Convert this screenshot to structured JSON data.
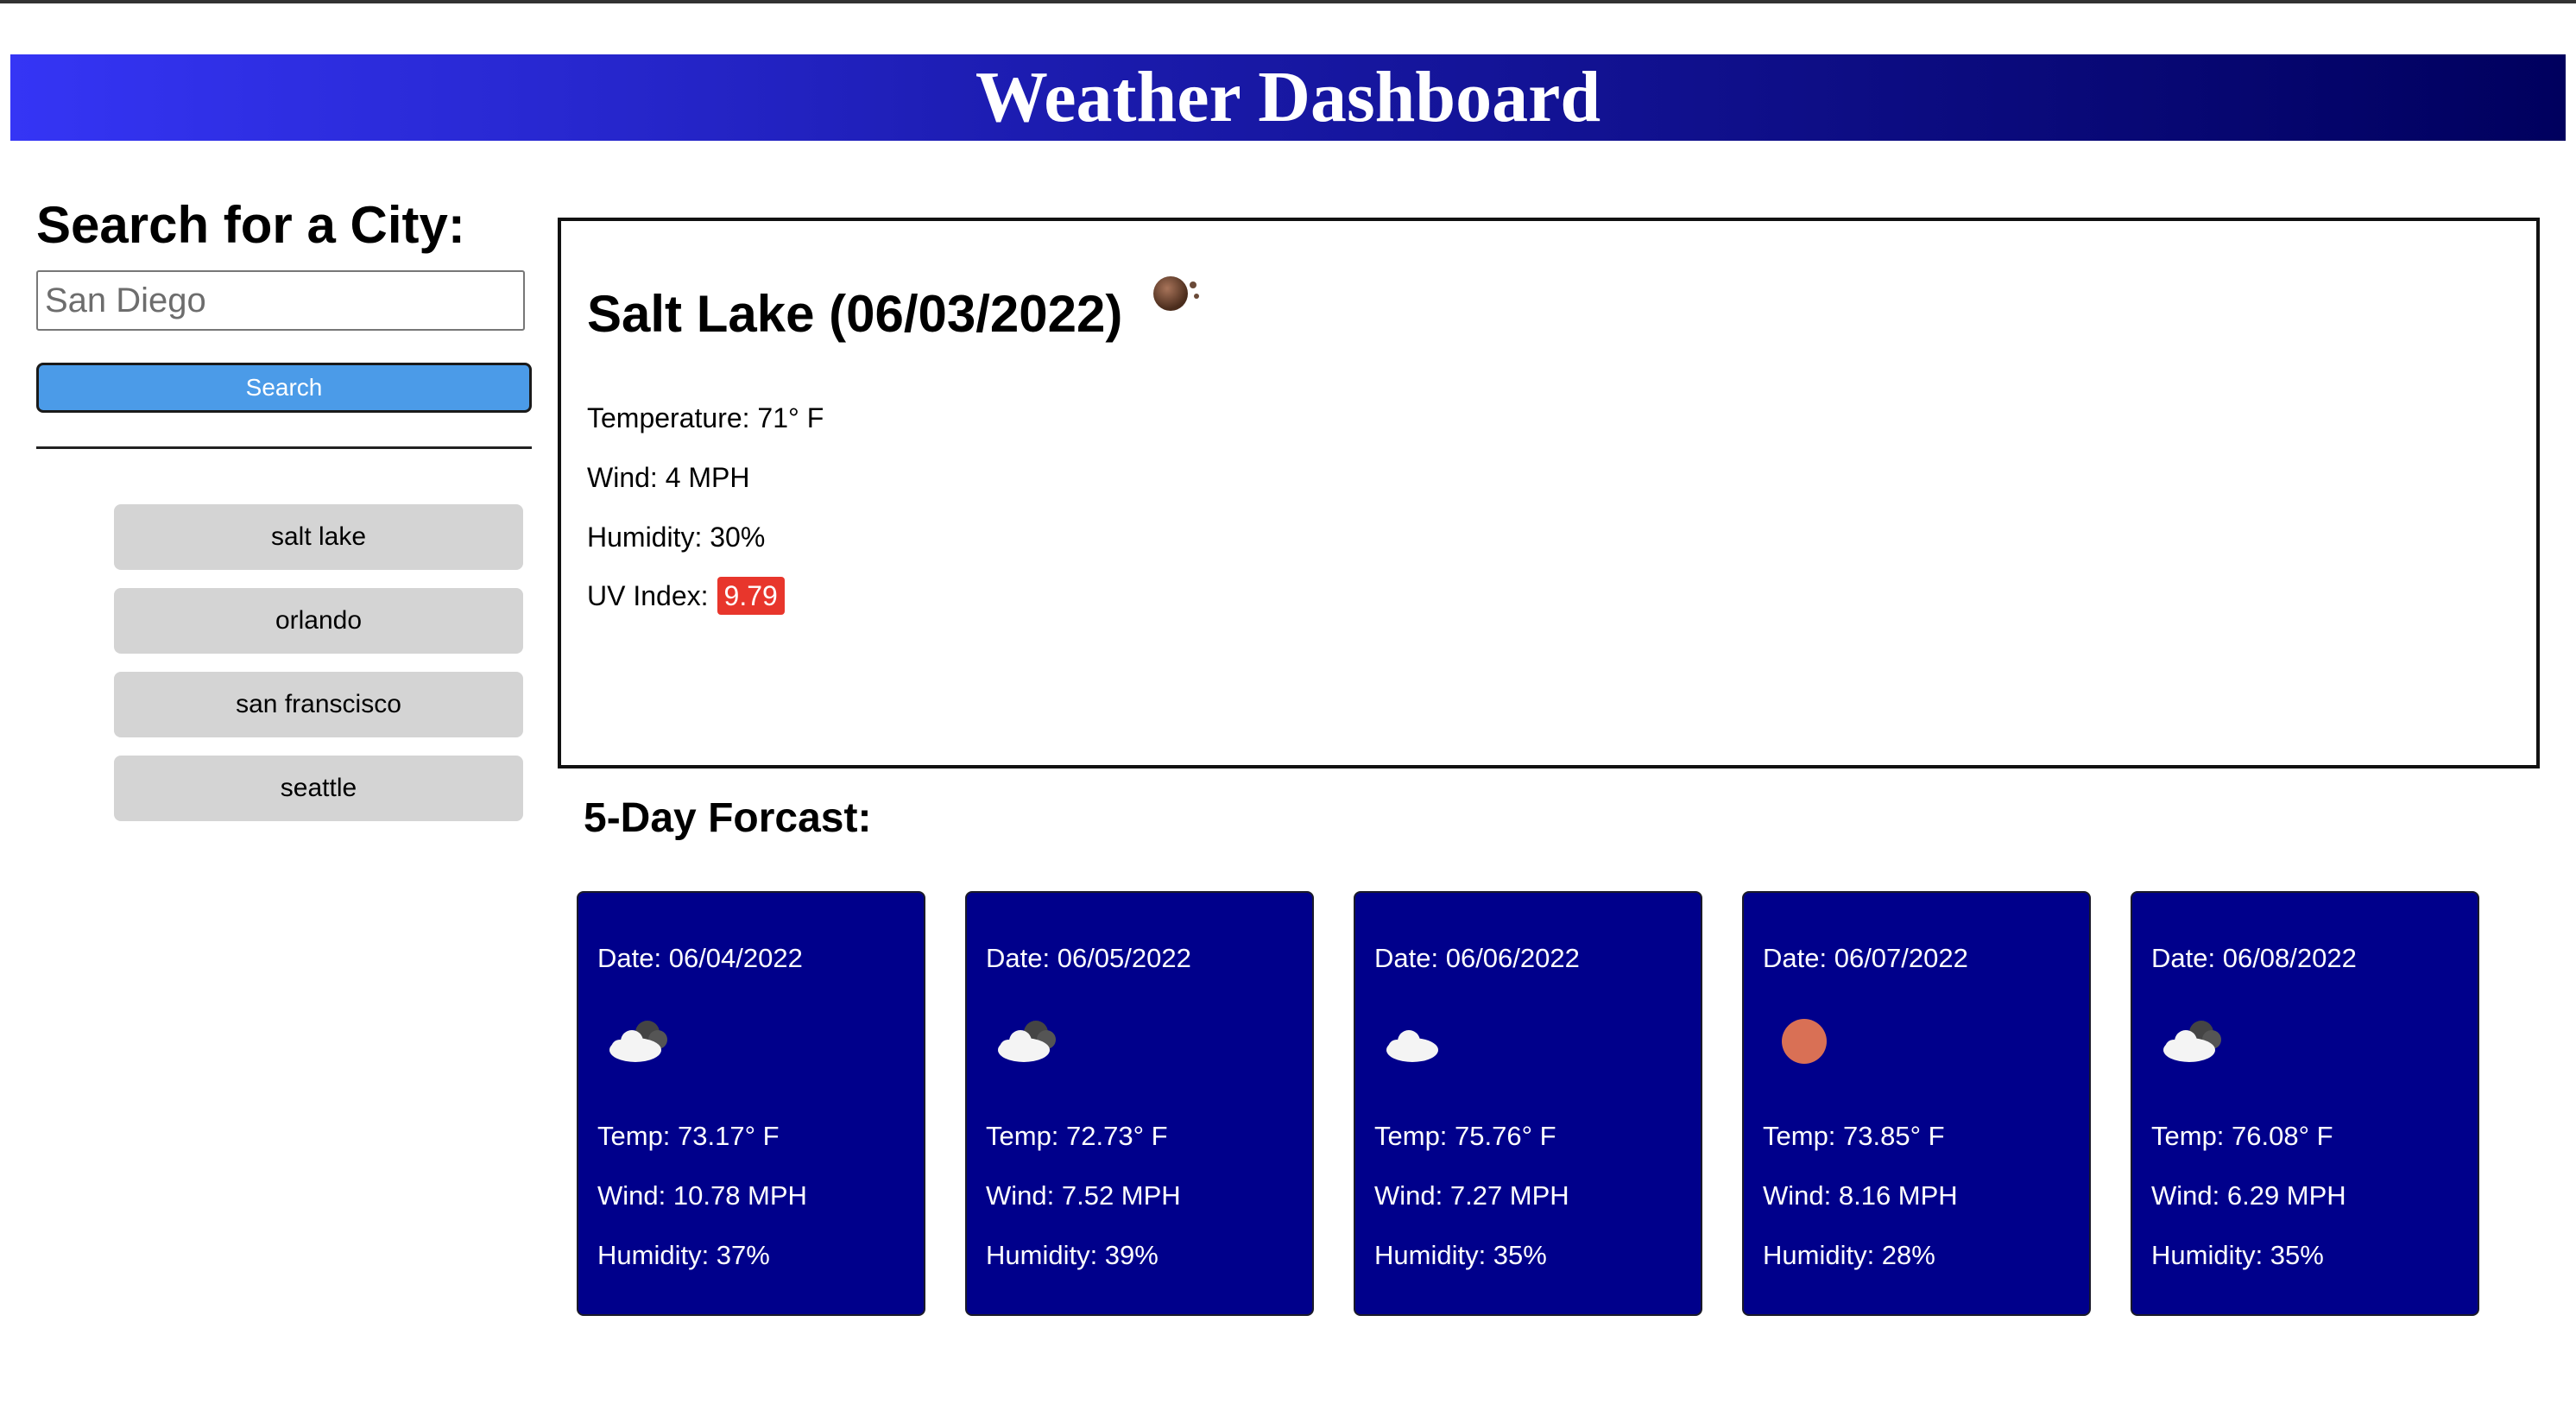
{
  "header": {
    "title": "Weather Dashboard"
  },
  "sidebar": {
    "title": "Search for a City:",
    "search_placeholder": "San Diego",
    "search_button_label": "Search",
    "history": [
      "salt lake",
      "orlando",
      "san franscisco",
      "seattle"
    ]
  },
  "current": {
    "title": "Salt Lake (06/03/2022)",
    "icon": "moon-icon",
    "temperature": "Temperature: 71° F",
    "wind": "Wind: 4 MPH",
    "humidity": "Humidity: 30%",
    "uv_label": "UV Index:",
    "uv_value": "9.79",
    "uv_color": "#e8362c"
  },
  "forecast": {
    "title": "5-Day Forcast:",
    "days": [
      {
        "date": "Date: 06/04/2022",
        "icon": "cloud-night-icon",
        "temp": "Temp: 73.17° F",
        "wind": "Wind: 10.78 MPH",
        "humidity": "Humidity: 37%"
      },
      {
        "date": "Date: 06/05/2022",
        "icon": "cloud-night-icon",
        "temp": "Temp: 72.73° F",
        "wind": "Wind: 7.52 MPH",
        "humidity": "Humidity: 39%"
      },
      {
        "date": "Date: 06/06/2022",
        "icon": "cloud-icon",
        "temp": "Temp: 75.76° F",
        "wind": "Wind: 7.27 MPH",
        "humidity": "Humidity: 35%"
      },
      {
        "date": "Date: 06/07/2022",
        "icon": "sun-icon",
        "temp": "Temp: 73.85° F",
        "wind": "Wind: 8.16 MPH",
        "humidity": "Humidity: 28%"
      },
      {
        "date": "Date: 06/08/2022",
        "icon": "cloud-night-icon",
        "temp": "Temp: 76.08° F",
        "wind": "Wind: 6.29 MPH",
        "humidity": "Humidity: 35%"
      }
    ]
  },
  "colors": {
    "header_gradient_start": "#3535f5",
    "header_gradient_end": "#00005e",
    "search_button": "#4b9be8",
    "history_button": "#d4d4d4",
    "forecast_card": "#00008b"
  }
}
